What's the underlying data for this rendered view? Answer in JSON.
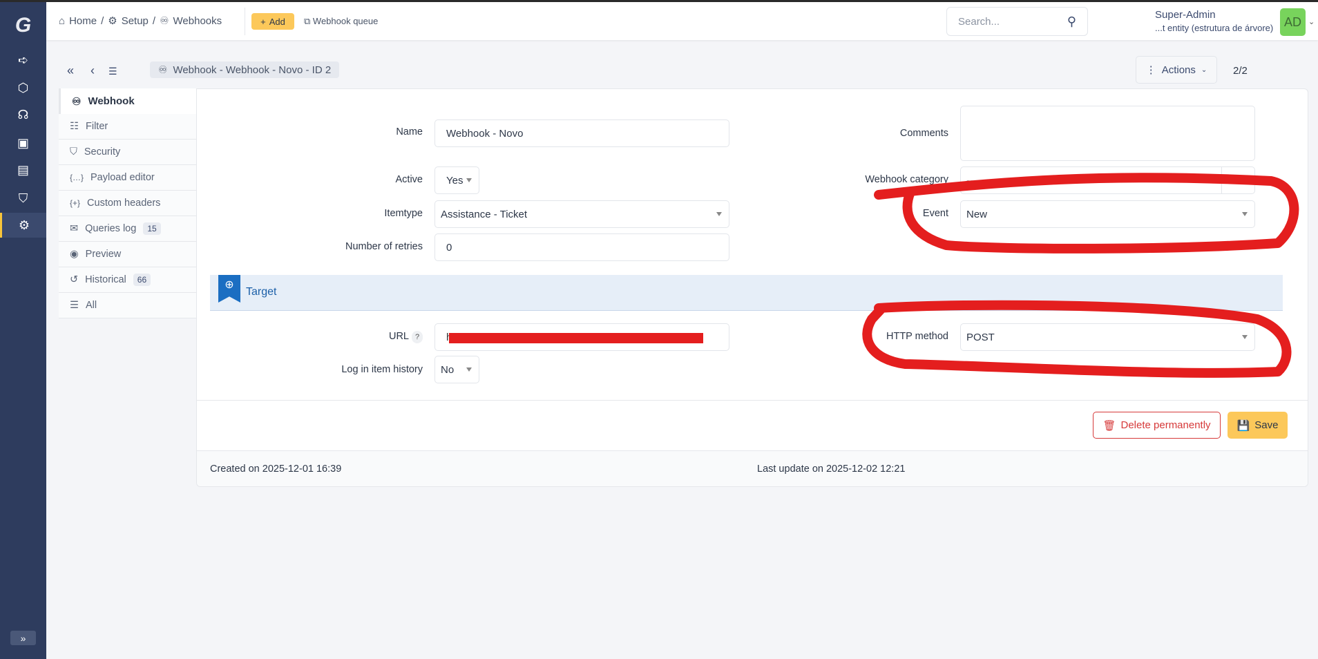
{
  "breadcrumb": {
    "home": "Home",
    "setup": "Setup",
    "webhooks": "Webhooks"
  },
  "header": {
    "add_label": "Add",
    "queue_label": "Webhook queue",
    "search_placeholder": "Search...",
    "user_name": "Super-Admin",
    "user_entity": "...t entity (estrutura de árvore)",
    "avatar_initials": "AD"
  },
  "toolbar": {
    "item_title": "Webhook -  Webhook - Novo - ID 2",
    "actions_label": "Actions",
    "pager": "2/2"
  },
  "tabs": [
    {
      "label": "Webhook",
      "icon": "webhook-icon"
    },
    {
      "label": "Filter",
      "icon": "filter-icon"
    },
    {
      "label": "Security",
      "icon": "shield-icon"
    },
    {
      "label": "Payload editor",
      "icon": "braces-icon"
    },
    {
      "label": "Custom headers",
      "icon": "braces-plus-icon"
    },
    {
      "label": "Queries log",
      "icon": "mail-icon",
      "badge": "15"
    },
    {
      "label": "Preview",
      "icon": "eye-icon"
    },
    {
      "label": "Historical",
      "icon": "history-icon",
      "badge": "66"
    },
    {
      "label": "All",
      "icon": "list-icon"
    }
  ],
  "form": {
    "name_label": "Name",
    "name_value": "Webhook - Novo",
    "active_label": "Active",
    "active_value": "Yes",
    "itemtype_label": "Itemtype",
    "itemtype_value": "Assistance - Ticket",
    "retries_label": "Number of retries",
    "retries_value": "0",
    "comments_label": "Comments",
    "comments_value": "",
    "category_label": "Webhook category",
    "category_value": "-----",
    "event_label": "Event",
    "event_value": "New",
    "section_target": "Target",
    "url_label": "URL",
    "url_help": "?",
    "log_label": "Log in item history",
    "log_value": "No",
    "http_label": "HTTP method",
    "http_value": "POST"
  },
  "actions": {
    "delete_label": "Delete permanently",
    "save_label": "Save"
  },
  "footer": {
    "created": "Created on 2025-12-01 16:39",
    "updated": "Last update on 2025-12-02 12:21"
  },
  "colors": {
    "sidebar": "#2e3c5e",
    "accent": "#fcc85a",
    "danger": "#d63939",
    "annotation": "#e41e1e"
  }
}
